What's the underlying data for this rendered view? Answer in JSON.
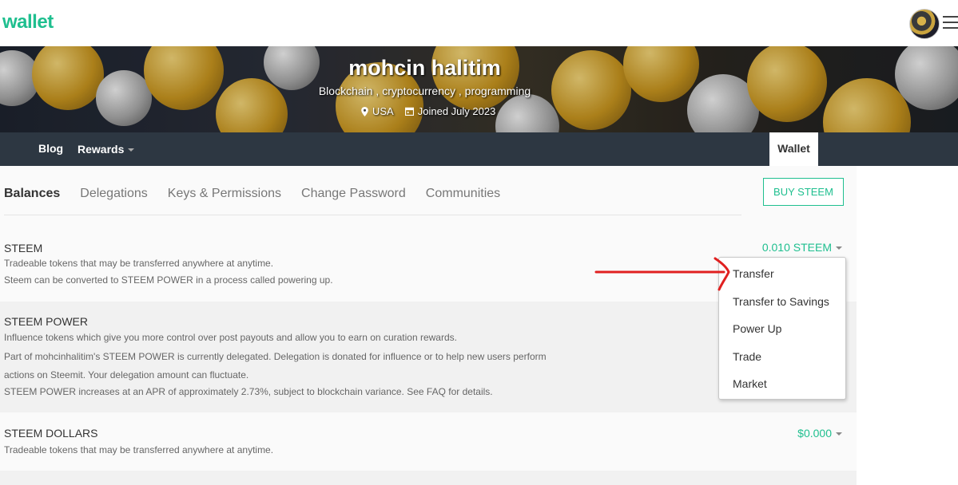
{
  "app": {
    "logo": "wallet"
  },
  "profile": {
    "name": "mohcin halitim",
    "bio": "Blockchain , cryptocurrency , programming",
    "location": "USA",
    "joined": "Joined July 2023"
  },
  "nav": {
    "blog": "Blog",
    "rewards": "Rewards",
    "wallet": "Wallet"
  },
  "tabs": [
    {
      "label": "Balances",
      "active": true
    },
    {
      "label": "Delegations"
    },
    {
      "label": "Keys & Permissions"
    },
    {
      "label": "Change Password"
    },
    {
      "label": "Communities"
    }
  ],
  "buy_button": "BUY STEEM",
  "balances": {
    "steem": {
      "title": "STEEM",
      "desc1": "Tradeable tokens that may be transferred anywhere at anytime.",
      "desc2": "Steem can be converted to STEEM POWER in a process called powering up.",
      "amount": "0.010 STEEM"
    },
    "steem_power": {
      "title": "STEEM POWER",
      "desc1": "Influence tokens which give you more control over post payouts and allow you to earn on curation rewards.",
      "desc2": "Part of mohcinhalitim's STEEM POWER is currently delegated. Delegation is donated for influence or to help new users perform actions on Steemit. Your delegation amount can fluctuate.",
      "desc3": "STEEM POWER increases at an APR of approximately 2.73%, subject to blockchain variance. See FAQ for details."
    },
    "steem_dollars": {
      "title": "STEEM DOLLARS",
      "desc1": "Tradeable tokens that may be transferred anywhere at anytime.",
      "amount": "$0.000"
    }
  },
  "dropdown": {
    "items": [
      "Transfer",
      "Transfer to Savings",
      "Power Up",
      "Trade",
      "Market"
    ]
  },
  "colors": {
    "accent": "#1fbf8f",
    "nav_bg": "#2d3742",
    "annotation_arrow": "#e02020"
  },
  "icons": [
    "location-pin-icon",
    "calendar-icon",
    "caret-down-icon",
    "hamburger-menu-icon"
  ]
}
